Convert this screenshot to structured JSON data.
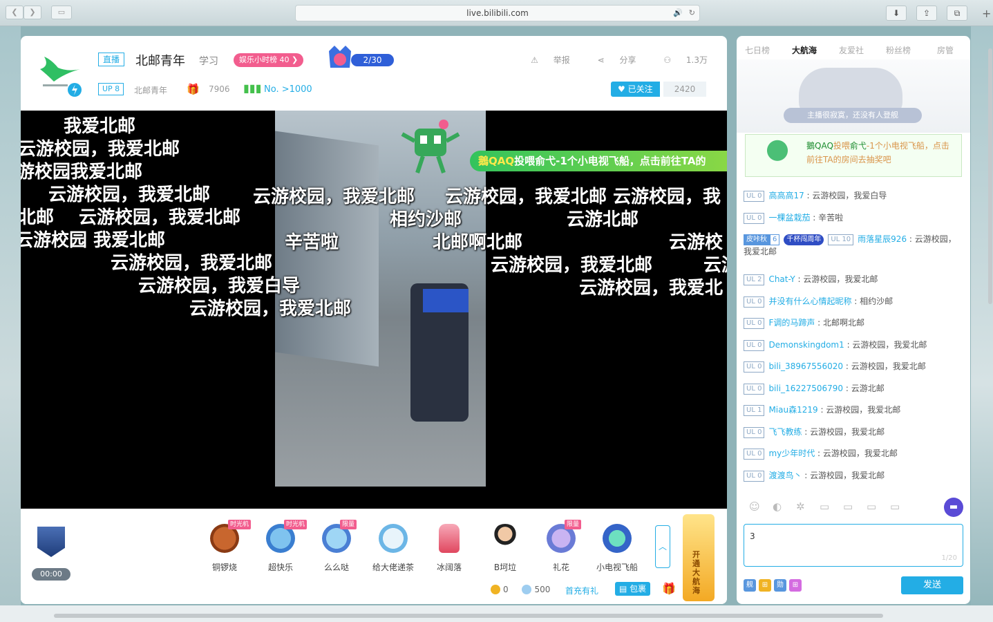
{
  "browser": {
    "url": "live.bilibili.com"
  },
  "header": {
    "live_badge": "直播",
    "room_title": "北邮青年",
    "category": "学习",
    "rank_pill": "娱乐小时榜 40 ❯",
    "guard_count": "2/30",
    "up_badge": "UP 8",
    "up_name": "北邮青年",
    "gift_value": "7906",
    "rank_value": "No. >1000",
    "report_label": "举报",
    "share_label": "分享",
    "viewers_label": "1.3万",
    "follow_label": "已关注",
    "follow_count": "2420"
  },
  "video": {
    "gift_banner_user": "鵝QAQ",
    "gift_banner_text": "投喂俞弋-1个小电视飞船，点击前往TA的",
    "danmaku": [
      "我爱北邮",
      "云游校园，我爱北邮",
      "游校园我爱北邮",
      "云游校园，我爱北邮",
      "北邮",
      "云游校园，我爱北邮",
      "云游校园 我爱北邮",
      "云游校园，我爱北邮",
      "云游校园，我爱白导",
      "云游校园，我爱北邮",
      "云游校园，我爱北邮",
      "相约沙邮",
      "辛苦啦",
      "北邮啊北邮",
      "云游校园，我爱北邮 云游校园，我",
      "云游北邮",
      "云游校",
      "云游校园，我爱北邮",
      "云游",
      "云游校园，我爱北"
    ]
  },
  "giftbar": {
    "pk_time": "00:00",
    "gifts": [
      {
        "name": "铜锣烧",
        "tag": "时光机"
      },
      {
        "name": "超快乐",
        "tag": "时光机"
      },
      {
        "name": "么么哒",
        "tag": "限量"
      },
      {
        "name": "给大佬递茶",
        "tag": ""
      },
      {
        "name": "冰阔落",
        "tag": ""
      },
      {
        "name": "B坷垃",
        "tag": ""
      },
      {
        "name": "礼花",
        "tag": "限量"
      },
      {
        "name": "小电视飞船",
        "tag": ""
      }
    ],
    "guard_promo": "开通大航海",
    "gold": "0",
    "silver": "500",
    "recharge": "首充有礼",
    "package": "包裹"
  },
  "side": {
    "tabs": [
      "七日榜",
      "大航海",
      "友爱社",
      "粉丝榜",
      "房管"
    ],
    "guard_empty_text": "主播很寂寞，还没有人登舰",
    "notice_user": "鵝QAQ",
    "notice_action": "投喂",
    "notice_target": "俞弋",
    "notice_text": "-1个小电视飞船，点击前往TA的房间去抽奖吧",
    "messages": [
      {
        "ul": "UL 0",
        "user": "高高高17",
        "text": "云游校园，我爱白导"
      },
      {
        "ul": "UL 0",
        "user": "一棵盆栽茄",
        "text": "辛苦啦"
      },
      {
        "medal": "皮咔秋",
        "medal_lv": "6",
        "title": "千杯闯周年",
        "ul": "UL 10",
        "user": "雨落星辰926",
        "text": "云游校园，我爱北邮"
      },
      {
        "ul": "UL 2",
        "user": "Chat-Y",
        "text": "云游校园，我爱北邮"
      },
      {
        "ul": "UL 0",
        "user": "并没有什么心情起昵称",
        "text": "相约沙邮"
      },
      {
        "ul": "UL 0",
        "user": "F调的马蹄声",
        "text": "北邮啊北邮"
      },
      {
        "ul": "UL 0",
        "user": "Demonskingdom1",
        "text": "云游校园，我爱北邮"
      },
      {
        "ul": "UL 0",
        "user": "bili_38967556020",
        "text": "云游校园，我爱北邮"
      },
      {
        "ul": "UL 0",
        "user": "bili_16227506790",
        "text": "云游北邮"
      },
      {
        "ul": "UL 1",
        "user": "Miau森1219",
        "text": "云游校园，我爱北邮"
      },
      {
        "ul": "UL 0",
        "user": "飞飞教练",
        "text": "云游校园，我爱北邮"
      },
      {
        "ul": "UL 0",
        "user": "my少年时代",
        "text": "云游校园，我爱北邮"
      },
      {
        "ul": "UL 0",
        "user": "渡渡鸟丶",
        "text": "云游校园，我爱北邮"
      }
    ],
    "input_value": "3",
    "input_count": "1/20",
    "mini_badges": [
      "舰",
      "⊞",
      "勋",
      "⊞"
    ],
    "send_label": "发送"
  },
  "colors": {
    "accent": "#23ade5",
    "pink": "#f25d8e",
    "green": "#44c04c"
  }
}
